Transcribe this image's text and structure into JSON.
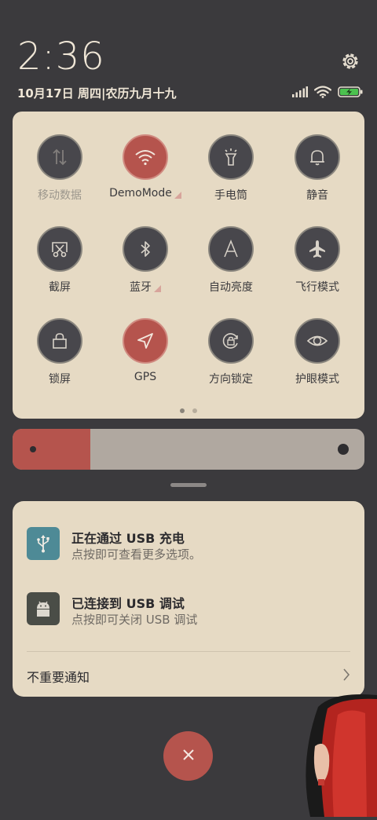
{
  "header": {
    "time": "2:36",
    "date": "10月17日 周四|农历九月十九"
  },
  "status_bar": {
    "icons": [
      "signal-icon",
      "wifi-icon",
      "battery-charging-icon"
    ]
  },
  "quick_settings": {
    "tiles": [
      {
        "label": "移动数据",
        "icon": "mobile-data-icon",
        "state": "disabled"
      },
      {
        "label": "DemoMode",
        "icon": "wifi-icon",
        "state": "active",
        "has_submenu": true
      },
      {
        "label": "手电筒",
        "icon": "flashlight-icon",
        "state": "off"
      },
      {
        "label": "静音",
        "icon": "bell-icon",
        "state": "off"
      },
      {
        "label": "截屏",
        "icon": "screenshot-icon",
        "state": "off"
      },
      {
        "label": "蓝牙",
        "icon": "bluetooth-icon",
        "state": "off",
        "has_submenu": true
      },
      {
        "label": "自动亮度",
        "icon": "auto-brightness-icon",
        "state": "off"
      },
      {
        "label": "飞行模式",
        "icon": "airplane-icon",
        "state": "off"
      },
      {
        "label": "锁屏",
        "icon": "lock-icon",
        "state": "off"
      },
      {
        "label": "GPS",
        "icon": "location-arrow-icon",
        "state": "active"
      },
      {
        "label": "方向锁定",
        "icon": "rotation-lock-icon",
        "state": "off"
      },
      {
        "label": "护眼模式",
        "icon": "eye-icon",
        "state": "off"
      }
    ],
    "page_count": 2,
    "current_page": 1
  },
  "brightness": {
    "level": 0.22
  },
  "notifications": {
    "items": [
      {
        "title": "正在通过 USB 充电",
        "subtitle": "点按即可查看更多选项。",
        "icon": "usb-icon",
        "icon_color": "#4e8a96"
      },
      {
        "title": "已连接到 USB 调试",
        "subtitle": "点按即可关闭 USB 调试",
        "icon": "android-icon",
        "icon_color": "#4a4d47"
      }
    ],
    "less_important_label": "不重要通知"
  },
  "colors": {
    "background": "#3b3a3d",
    "panel": "#e6dac4",
    "accent": "#b5544d",
    "tile_off": "#48474c"
  }
}
